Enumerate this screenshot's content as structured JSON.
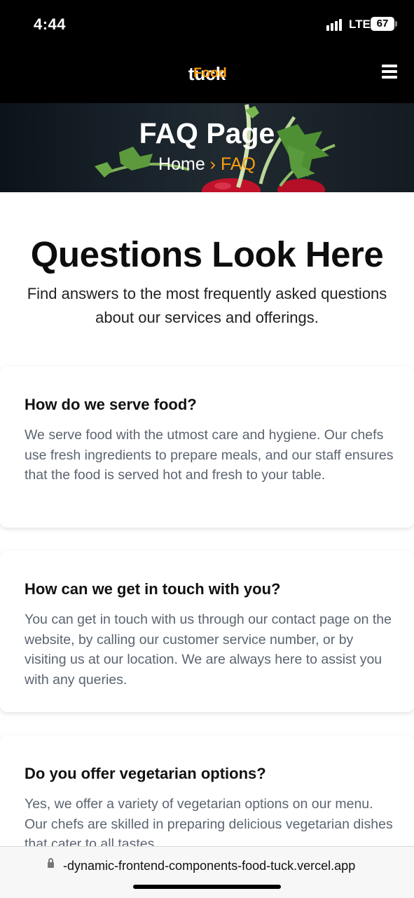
{
  "status": {
    "time": "4:44",
    "network": "LTE",
    "battery": "67"
  },
  "nav": {
    "logo_part1": "Food",
    "logo_part2": "tuck",
    "menu_icon": "hamburger-menu-icon"
  },
  "hero": {
    "title": "FAQ Page",
    "crumb_home": "Home",
    "crumb_sep": "›",
    "crumb_current": "FAQ"
  },
  "intro": {
    "heading": "Questions Look Here",
    "subtitle": "Find answers to the most frequently asked questions about our services and offerings."
  },
  "faqs": [
    {
      "question": "How do we serve food?",
      "answer": "We serve food with the utmost care and hygiene. Our chefs use fresh ingredients to prepare meals, and our staff ensures that the food is served hot and fresh to your table."
    },
    {
      "question": "How can we get in touch with you?",
      "answer": "You can get in touch with us through our contact page on the website, by calling our customer service number, or by visiting us at our location. We are always here to assist you with any queries."
    },
    {
      "question": "Do you offer vegetarian options?",
      "answer": "Yes, we offer a variety of vegetarian options on our menu. Our chefs are skilled in preparing delicious vegetarian dishes that cater to all tastes."
    }
  ],
  "browser": {
    "url": "-dynamic-frontend-components-food-tuck.vercel.app"
  },
  "colors": {
    "accent": "#ff9f0d",
    "header_bg": "#000000",
    "answer_text": "#5b6470"
  }
}
